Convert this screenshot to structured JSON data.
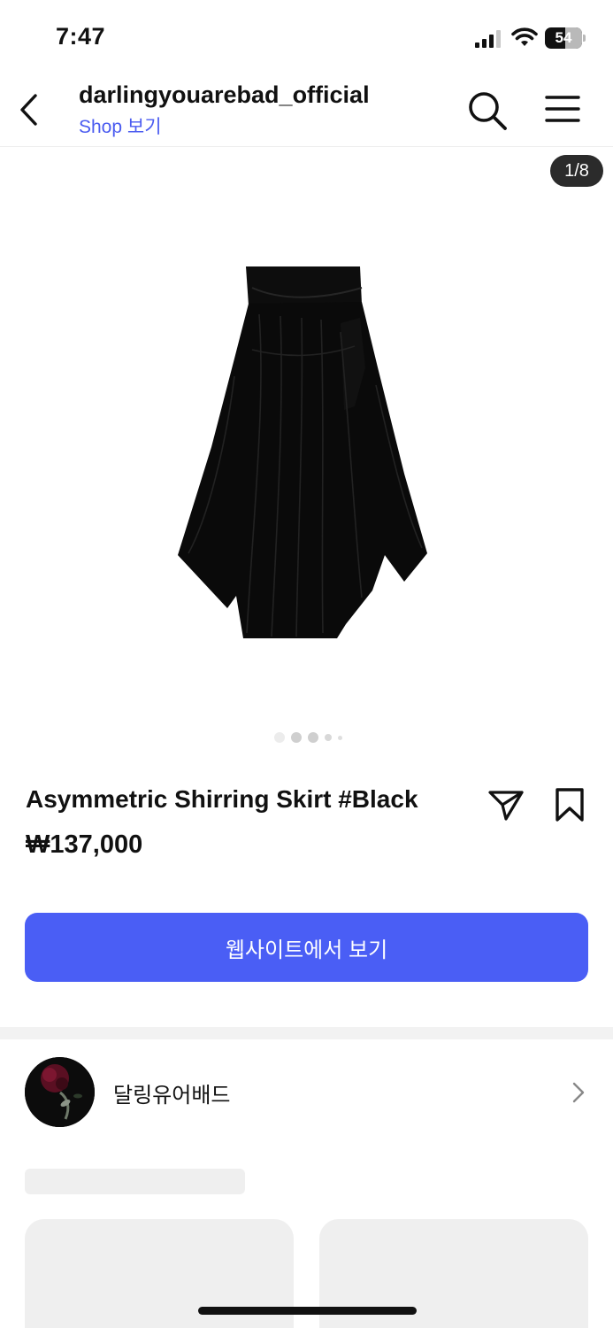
{
  "status_bar": {
    "time": "7:47",
    "battery_level": "54",
    "battery_fraction": 0.54
  },
  "header": {
    "title": "darlingyouarebad_official",
    "subtitle": "Shop 보기",
    "back_icon": "chevron-left-icon",
    "search_icon": "search-icon",
    "menu_icon": "hamburger-menu-icon"
  },
  "gallery": {
    "counter": "1/8",
    "dot_count": 5,
    "active_dot": 0
  },
  "product": {
    "name": "Asymmetric Shirring Skirt #Black",
    "price": "₩137,000",
    "share_icon": "paper-plane-icon",
    "save_icon": "bookmark-icon"
  },
  "cta": {
    "label": "웹사이트에서 보기"
  },
  "seller": {
    "name": "달링유어배드",
    "chevron_icon": "chevron-right-icon"
  },
  "colors": {
    "accent": "#4a5ef5",
    "link": "#4a5bf0",
    "skeleton": "#efefef"
  }
}
